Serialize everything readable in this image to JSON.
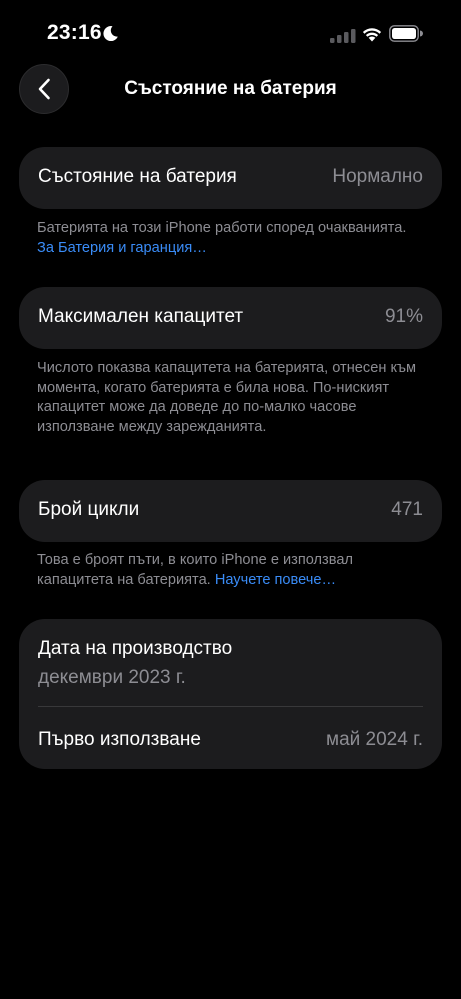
{
  "status_bar": {
    "time": "23:16",
    "icons": [
      "moon-icon",
      "signal-icon",
      "wifi-icon",
      "battery-icon"
    ]
  },
  "nav": {
    "back_icon": "chevron-left-icon",
    "title": "Състояние на батерия"
  },
  "battery_state": {
    "label": "Състояние на батерия",
    "value": "Нормално",
    "note": "Батерията на този iPhone работи според очакванията.",
    "link": "За Батерия и гаранция…"
  },
  "max_capacity": {
    "label": "Максимален капацитет",
    "value": "91%",
    "note": "Числото показва капацитета на батерията, отнесен към момента, когато батерията е била нова. По-ниският капацитет може да доведе до по-малко часове използване между зарежданията."
  },
  "cycle_count": {
    "label": "Брой цикли",
    "value": "471",
    "note": "Това е броят пъти, в които iPhone е използвал капацитета на батерията.",
    "link": "Научете повече…"
  },
  "dates": {
    "manufacture_label": "Дата на производство",
    "manufacture_value": "декември 2023 г.",
    "first_use_label": "Първо използване",
    "first_use_value": "май 2024 г."
  },
  "colors": {
    "background": "#000000",
    "card": "#1c1c1e",
    "secondary_text": "#8d8d93",
    "link": "#3a8cf7"
  }
}
